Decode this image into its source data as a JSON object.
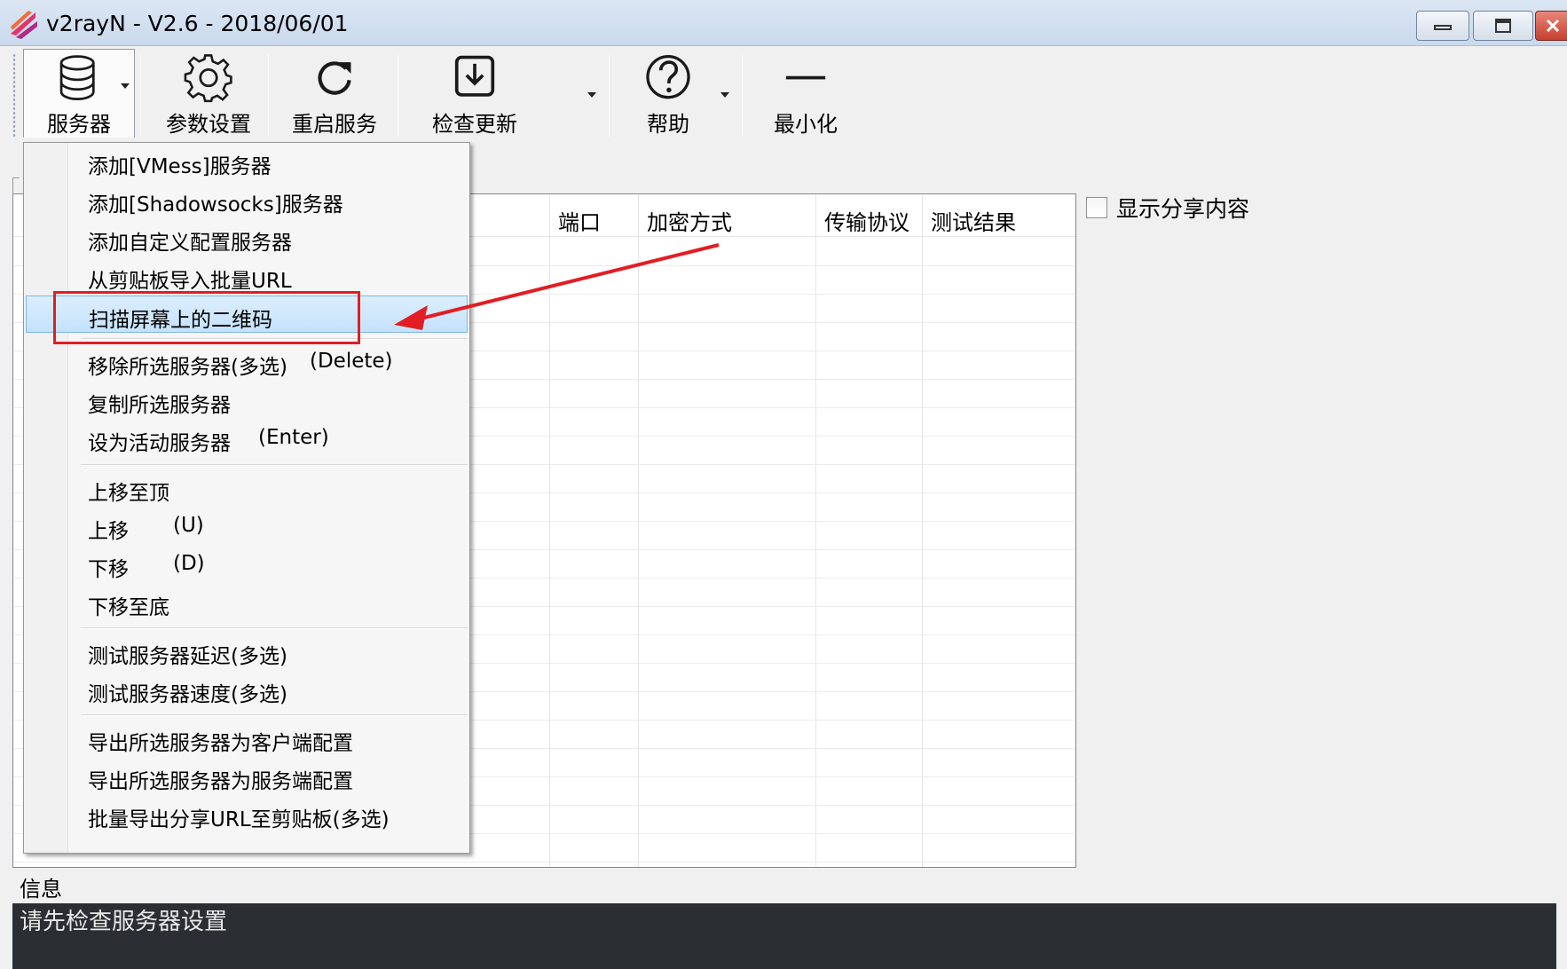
{
  "window": {
    "title": "v2rayN - V2.6 - 2018/06/01",
    "icon": "v2rayn-app-icon",
    "controls": [
      "minimize-icon",
      "maximize-icon",
      "close-icon"
    ]
  },
  "toolbar": {
    "items": [
      {
        "label": "服务器",
        "icon": "database-icon",
        "dropdown": true
      },
      {
        "label": "参数设置",
        "icon": "gear-icon",
        "dropdown": false
      },
      {
        "label": "重启服务",
        "icon": "refresh-icon",
        "dropdown": false
      },
      {
        "label": "检查更新",
        "icon": "download-icon",
        "dropdown": true
      },
      {
        "label": "帮助",
        "icon": "help-icon",
        "dropdown": true
      },
      {
        "label": "最小化",
        "icon": "minimize-dash-icon",
        "dropdown": false
      }
    ]
  },
  "grid": {
    "columns": [
      "端口",
      "加密方式",
      "传输协议",
      "测试结果"
    ]
  },
  "share": {
    "label": "显示分享内容",
    "checked": false
  },
  "info": {
    "label": "信息",
    "text": "请先检查服务器设置"
  },
  "menu": {
    "items": [
      {
        "label": "添加[VMess]服务器",
        "shortcut": ""
      },
      {
        "label": "添加[Shadowsocks]服务器",
        "shortcut": ""
      },
      {
        "label": "添加自定义配置服务器",
        "shortcut": ""
      },
      {
        "label": "从剪贴板导入批量URL",
        "shortcut": ""
      },
      {
        "label": "扫描屏幕上的二维码",
        "shortcut": "",
        "highlighted": true
      },
      {
        "label": "移除所选服务器(多选)",
        "shortcut": "(Delete)"
      },
      {
        "label": "复制所选服务器",
        "shortcut": ""
      },
      {
        "label": "设为活动服务器",
        "shortcut": "(Enter)"
      },
      {
        "label": "上移至顶",
        "shortcut": ""
      },
      {
        "label": "上移",
        "shortcut": "(U)"
      },
      {
        "label": "下移",
        "shortcut": "(D)"
      },
      {
        "label": "下移至底",
        "shortcut": ""
      },
      {
        "label": "测试服务器延迟(多选)",
        "shortcut": ""
      },
      {
        "label": "测试服务器速度(多选)",
        "shortcut": ""
      },
      {
        "label": "导出所选服务器为客户端配置",
        "shortcut": ""
      },
      {
        "label": "导出所选服务器为服务端配置",
        "shortcut": ""
      },
      {
        "label": "批量导出分享URL至剪贴板(多选)",
        "shortcut": ""
      }
    ]
  },
  "colors": {
    "highlight": "#c4e2fc",
    "annotation": "#e21d24",
    "info_bg": "#2b2f33"
  }
}
